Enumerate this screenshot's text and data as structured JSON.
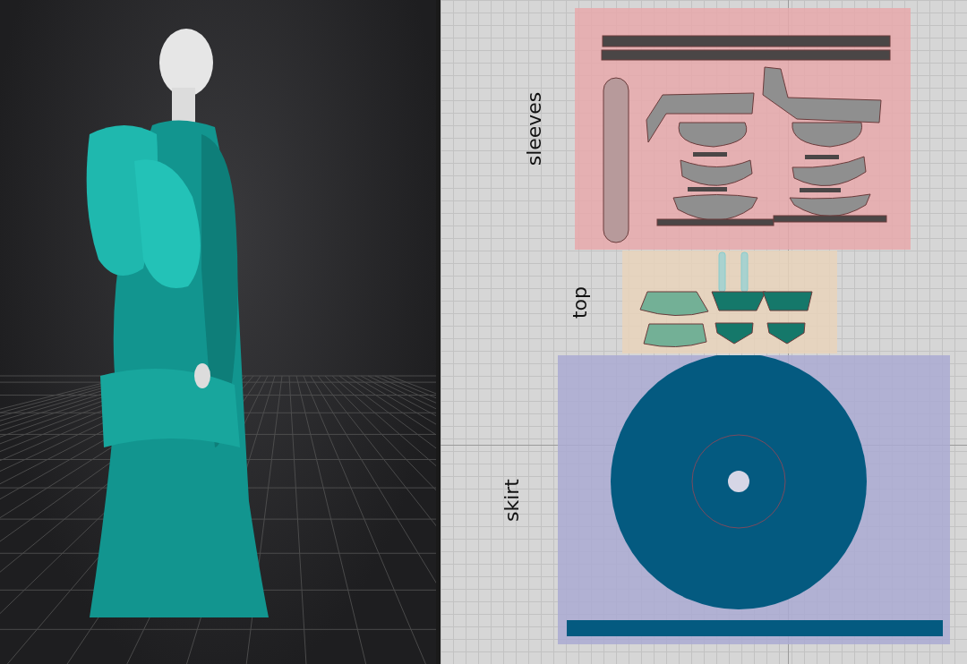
{
  "pattern_window": {
    "groups": [
      {
        "label": "sleeves",
        "kind": "sleeve",
        "color": "#e8a9ac"
      },
      {
        "label": "top",
        "kind": "bodice",
        "color": "#e9d3bb"
      },
      {
        "label": "skirt",
        "kind": "circle",
        "color": "#aaaad2"
      }
    ]
  }
}
